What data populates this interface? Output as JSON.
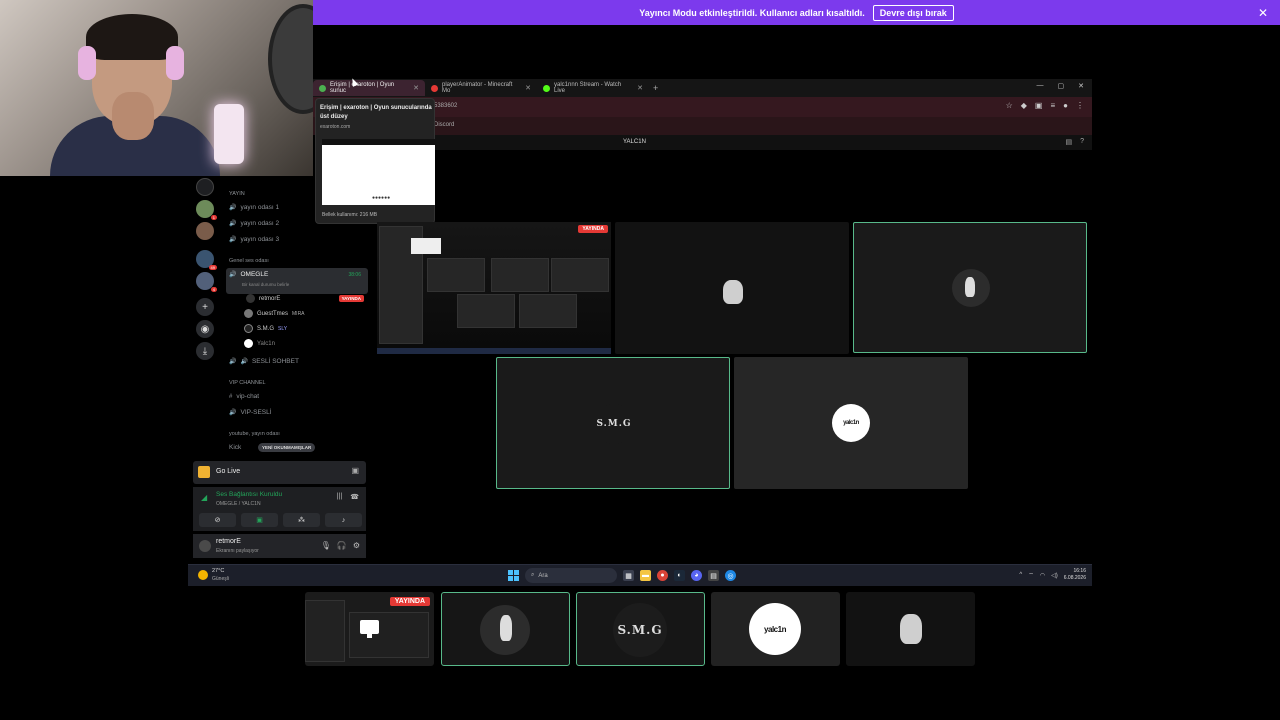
{
  "banner": {
    "message": "Yayıncı Modu etkinleştirildi. Kullanıcı adları kısaltıldı.",
    "disable_label": "Devre dışı bırak",
    "close_icon": "close-icon"
  },
  "browser": {
    "tabs": [
      {
        "title": "Erişim | exaroton | Oyun sunuc",
        "favicon_color": "#4caf50",
        "active": true
      },
      {
        "title": "playerAnimator - Minecraft Mo",
        "favicon_color": "#e53935",
        "active": false
      },
      {
        "title": "yalc1nnn Stream - Watch Live",
        "favicon_color": "#53fc18",
        "active": false
      }
    ],
    "new_tab": "+",
    "url_fragment": "5383602",
    "bookmark": "Discord",
    "hover_card": {
      "title": "Erişim | exaroton | Oyun sunucularında üst düzey",
      "domain": "exaroton.com",
      "memory": "Bellek kullanımı: 216 MB"
    }
  },
  "discord": {
    "window_title": "YALC1N",
    "categories": {
      "yayin": "YAYIN",
      "genel": "Genel ses odası",
      "vip": "VIP CHANNEL",
      "youtube": "youtube, yayın odası"
    },
    "channels": {
      "yayin1": "yayın odası 1",
      "yayin2": "yayın odası 2",
      "yayin3": "yayın odası 3",
      "omegle": "OMEGLE",
      "omegle_time": "38:06",
      "omegle_status": "Bir kanal durumu belirle",
      "sesli_sohbet": "SESLİ SOHBET",
      "vip_chat": "vip-chat",
      "vip_sesli": "VIP-SESLİ",
      "kick": "Kick"
    },
    "members": [
      {
        "name": "retmorE",
        "badge": "YAYINDA"
      },
      {
        "name": "GuestTmes",
        "extra": "MIRA"
      },
      {
        "name": "S.M.G",
        "extra": "SLY"
      },
      {
        "name": "Yalc1n",
        "extra": ""
      }
    ],
    "new_mentions": "YENİ OKUNMAMIŞLAR",
    "go_live": "Go Live",
    "voice": {
      "connected": "Ses Bağlantısı Kuruldu",
      "location": "OMEGLE / YALC1N"
    },
    "user": {
      "name": "retmorE",
      "status": "Ekranını paylaşıyor"
    },
    "live_badge": "YAYINDA",
    "server_badges": [
      "1",
      "49",
      "4"
    ]
  },
  "stage": {
    "tiles": [
      {
        "id": "screen",
        "kind": "screenshare",
        "live": "YAYINDA"
      },
      {
        "id": "figure1",
        "kind": "avatar"
      },
      {
        "id": "figure2",
        "kind": "avatar",
        "speaking": true
      },
      {
        "id": "smg",
        "kind": "avatar",
        "label": "S.M.G",
        "speaking": true
      },
      {
        "id": "yalcin",
        "kind": "avatar",
        "label": "yalc1n"
      }
    ]
  },
  "strip": {
    "live": "YAYINDA",
    "smg": "S.M.G",
    "yalcin": "yalc1n"
  },
  "taskbar": {
    "temperature": "27°C",
    "condition": "Güneşli",
    "search_placeholder": "Ara",
    "time": "16:16",
    "date": "6.08.2026"
  },
  "colors": {
    "banner": "#7c3aed",
    "speaking": "#58b98a",
    "live": "#e53935",
    "connected": "#23a55a"
  }
}
